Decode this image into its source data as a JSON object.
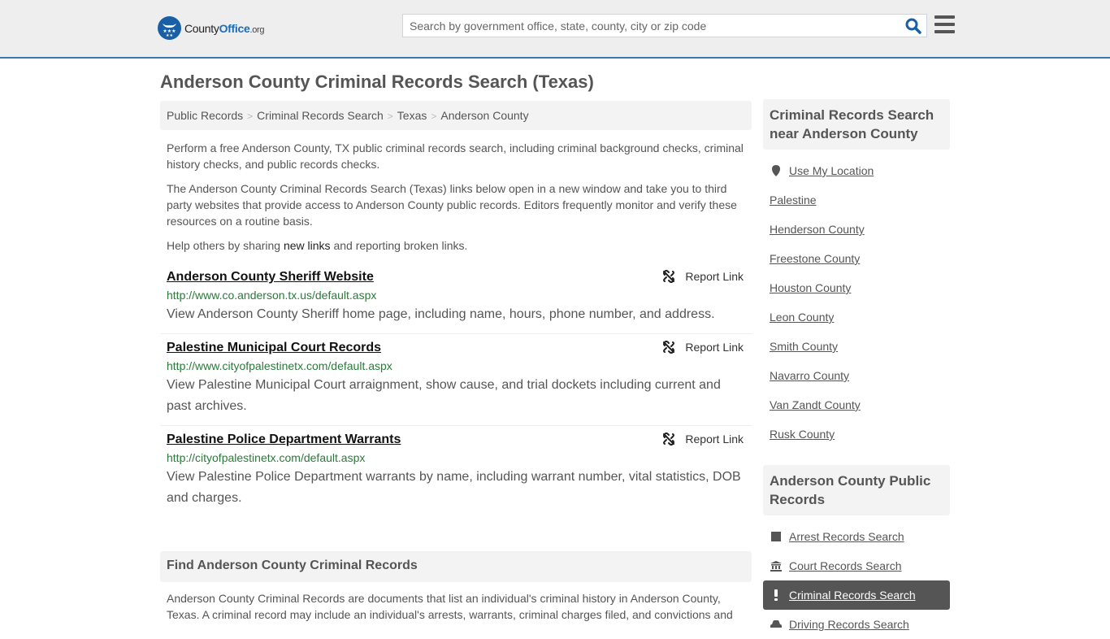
{
  "header": {
    "logo": {
      "name_main": "County",
      "name_brand": "Office",
      "name_tld": ".org"
    },
    "search": {
      "placeholder": "Search by government office, state, county, city or zip code",
      "value": ""
    },
    "search_icon": "search-icon",
    "menu_icon": "hamburger-menu-icon",
    "accent_color": "#3a7aad"
  },
  "page": {
    "title": "Anderson County Criminal Records Search (Texas)"
  },
  "breadcrumb": [
    {
      "label": "Public Records"
    },
    {
      "label": "Criminal Records Search"
    },
    {
      "label": "Texas"
    },
    {
      "label": "Anderson County"
    }
  ],
  "intro": {
    "p1": "Perform a free Anderson County, TX public criminal records search, including criminal background checks, criminal history checks, and public records checks.",
    "p2": "The Anderson County Criminal Records Search (Texas) links below open in a new window and take you to third party websites that provide access to Anderson County public records. Editors frequently monitor and verify these resources on a routine basis.",
    "p3_before": "Help others by sharing ",
    "p3_link": "new links",
    "p3_after": " and reporting broken links."
  },
  "results": [
    {
      "title": "Anderson County Sheriff Website",
      "url": "http://www.co.anderson.tx.us/default.aspx",
      "description": "View Anderson County Sheriff home page, including name, hours, phone number, and address.",
      "report_label": "Report Link"
    },
    {
      "title": "Palestine Municipal Court Records",
      "url": "http://www.cityofpalestinetx.com/default.aspx",
      "description": "View Palestine Municipal Court arraignment, show cause, and trial dockets including current and past archives.",
      "report_label": "Report Link"
    },
    {
      "title": "Palestine Police Department Warrants",
      "url": "http://cityofpalestinetx.com/default.aspx",
      "description": "View Palestine Police Department warrants by name, including warrant number, vital statistics, DOB and charges.",
      "report_label": "Report Link"
    }
  ],
  "find_section": {
    "heading": "Find Anderson County Criminal Records",
    "text": "Anderson County Criminal Records are documents that list an individual's criminal history in Anderson County, Texas. A criminal record may include an individual's arrests, warrants, criminal charges filed, and convictions and"
  },
  "sidebar": {
    "nearby": {
      "heading": "Criminal Records Search near Anderson County",
      "use_location": "Use My Location",
      "items": [
        "Palestine",
        "Henderson County",
        "Freestone County",
        "Houston County",
        "Leon County",
        "Smith County",
        "Navarro County",
        "Van Zandt County",
        "Rusk County"
      ]
    },
    "public_records": {
      "heading": "Anderson County Public Records",
      "items": [
        {
          "label": "Arrest Records Search",
          "icon": "square-icon",
          "active": false
        },
        {
          "label": "Court Records Search",
          "icon": "courthouse-icon",
          "active": false
        },
        {
          "label": "Criminal Records Search",
          "icon": "exclamation-icon",
          "active": true
        },
        {
          "label": "Driving Records Search",
          "icon": "car-icon",
          "active": false
        }
      ]
    }
  }
}
